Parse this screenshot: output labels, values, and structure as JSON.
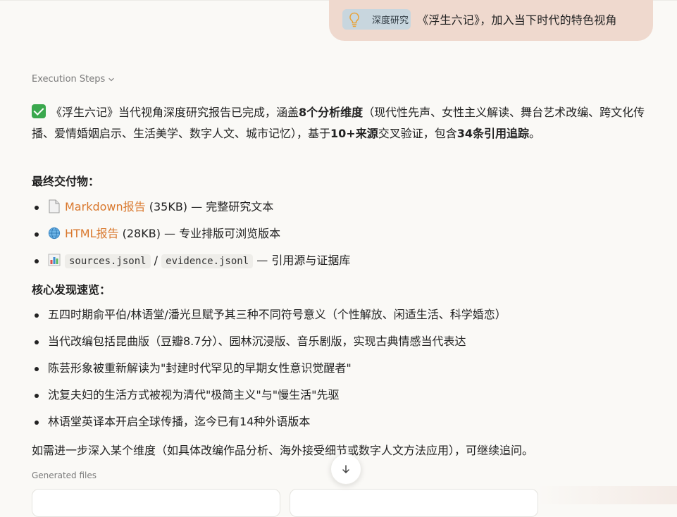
{
  "prompt": {
    "mode_label": "深度研究",
    "text": "《浮生六记》，加入当下时代的特色视角"
  },
  "execution_steps_label": "Execution Steps",
  "summary": {
    "part1": "《浮生六记》当代视角深度研究报告已完成，涵盖",
    "bold1": "8个分析维度",
    "part2": "（现代性先声、女性主义解读、舞台艺术改编、跨文化传播、爱情婚姻启示、生活美学、数字人文、城市记忆），基于",
    "bold2": "10+来源",
    "part3": "交叉验证，包含",
    "bold3": "34条引用追踪",
    "part4": "。"
  },
  "deliverables": {
    "heading": "最终交付物：",
    "items": [
      {
        "icon": "document-icon",
        "link": "Markdown报告",
        "rest": " (35KB) — 完整研究文本"
      },
      {
        "icon": "globe-icon",
        "link": "HTML报告",
        "rest": " (28KB) — 专业排版可浏览版本"
      },
      {
        "icon": "bar-chart-icon",
        "code1": "sources.jsonl",
        "sep": " / ",
        "code2": "evidence.jsonl",
        "rest": " — 引用源与证据库"
      }
    ]
  },
  "findings": {
    "heading": "核心发现速览：",
    "items": [
      "五四时期俞平伯/林语堂/潘光旦赋予其三种不同符号意义（个性解放、闲适生活、科学婚恋）",
      "当代改编包括昆曲版（豆瓣8.7分）、园林沉浸版、音乐剧版，实现古典情感当代表达",
      "陈芸形象被重新解读为\"封建时代罕见的早期女性意识觉醒者\"",
      "沈复夫妇的生活方式被视为清代\"极简主义\"与\"慢生活\"先驱",
      "林语堂英译本开启全球传播，迄今已有14种外语版本"
    ]
  },
  "followup": "如需进一步深入某个维度（如具体改编作品分析、海外接受细节或数字人文方法应用），可继续追问。",
  "generated_files_label": "Generated files"
}
